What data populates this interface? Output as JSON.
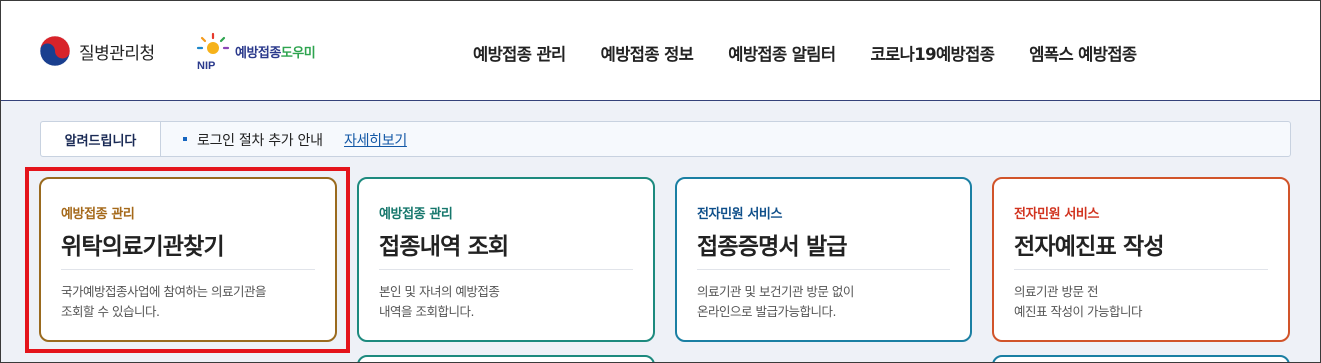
{
  "header": {
    "kdca_logo_text": "질병관리청",
    "nip_logo_mark": "NIP",
    "nip_logo_text_main": "예방접종",
    "nip_logo_text_sub": "도우미",
    "nav": [
      {
        "label": "예방접종 관리"
      },
      {
        "label": "예방접종 정보"
      },
      {
        "label": "예방접종 알림터"
      },
      {
        "label": "코로나19예방접종"
      },
      {
        "label": "엠폭스 예방접종"
      }
    ]
  },
  "notice": {
    "tab_label": "알려드립니다",
    "text": "로그인 절차 추가 안내",
    "link": "자세히보기"
  },
  "cards": [
    {
      "category": "예방접종 관리",
      "title": "위탁의료기관찾기",
      "desc_line1": "국가예방접종사업에 참여하는 의료기관을",
      "desc_line2": "조회할 수 있습니다.",
      "accent": "#9a6a1e",
      "category_color": "#a5691a"
    },
    {
      "category": "예방접종 관리",
      "title": "접종내역 조회",
      "desc_line1": "본인 및 자녀의 예방접종",
      "desc_line2": "내역을 조회합니다.",
      "accent": "#1d8a7e",
      "category_color": "#16776c"
    },
    {
      "category": "전자민원 서비스",
      "title": "접종증명서 발급",
      "desc_line1": "의료기관 및 보건기관 방문 없이",
      "desc_line2": "온라인으로 발급가능합니다.",
      "accent": "#1a7fa3",
      "category_color": "#0f4f8a"
    },
    {
      "category": "전자민원 서비스",
      "title": "전자예진표 작성",
      "desc_line1": "의료기관 방문 전",
      "desc_line2": "예진표 작성이 가능합니다",
      "accent": "#d1542a",
      "category_color": "#d1331f"
    }
  ],
  "highlight_color": "#e4141b"
}
